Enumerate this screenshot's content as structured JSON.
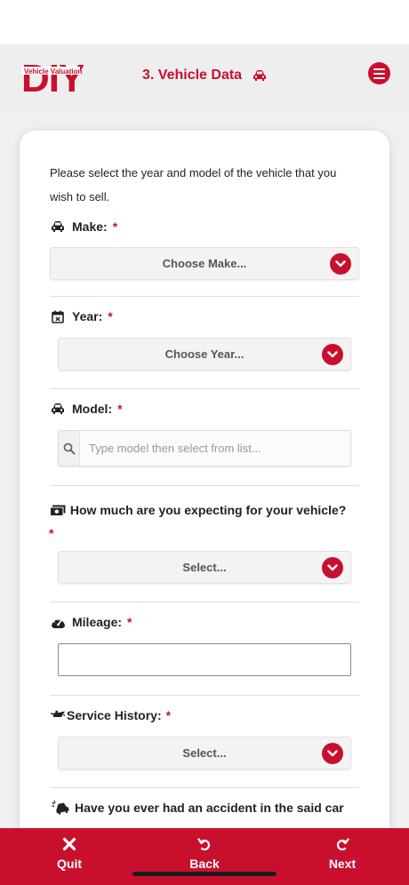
{
  "header": {
    "logo_text": "DIY",
    "logo_subtext": "Vehicle Valuation",
    "title": "3. Vehicle Data",
    "title_icon": "car-icon",
    "menu_icon": "hamburger-icon"
  },
  "form": {
    "intro": "Please select the year and model of the vehicle that you wish to sell.",
    "required_mark": "*",
    "make": {
      "label": "Make:",
      "icon": "car-icon",
      "value": "Choose Make..."
    },
    "year": {
      "label": "Year:",
      "icon": "calendar-icon",
      "value": "Choose Year..."
    },
    "model": {
      "label": "Model:",
      "icon": "car-icon",
      "placeholder": "Type model then select from list..."
    },
    "expecting": {
      "label": "How much are you expecting for your vehicle?",
      "icon": "money-icon",
      "value": "Select..."
    },
    "mileage": {
      "label": "Mileage:",
      "icon": "speedometer-icon",
      "value": ""
    },
    "service_history": {
      "label": "Service History:",
      "icon": "oil-can-icon",
      "value": "Select..."
    },
    "accident": {
      "label": "Have you ever had an accident in the said car",
      "icon": "car-crash-icon"
    }
  },
  "bottom_nav": {
    "quit": "Quit",
    "back": "Back",
    "next": "Next"
  },
  "colors": {
    "brand_red": "#c8102e",
    "header_bg": "#eeeeee",
    "card_bg": "#ffffff"
  }
}
